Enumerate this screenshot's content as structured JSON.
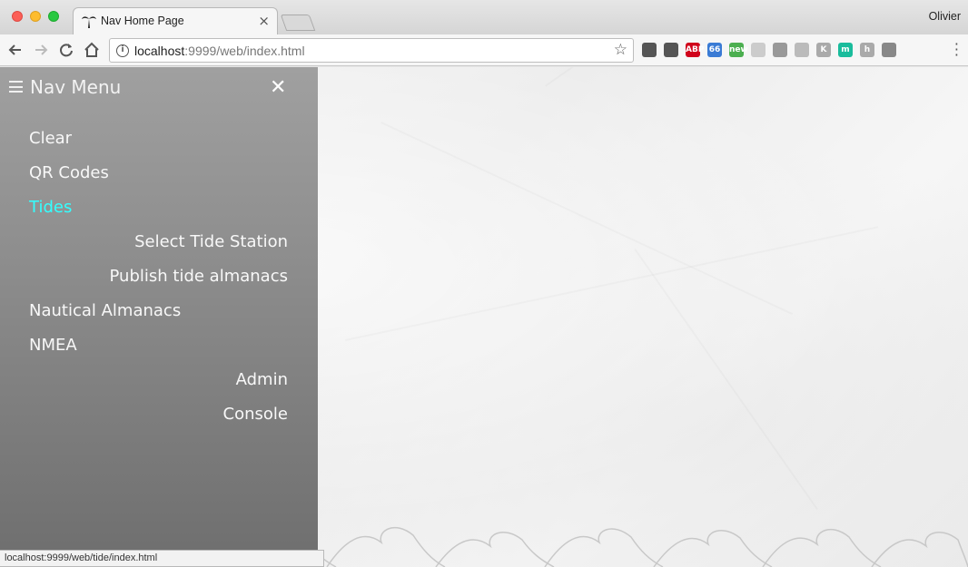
{
  "browser": {
    "tab_title": "Nav Home Page",
    "tab_close": "×",
    "profile_name": "Olivier",
    "url_host": "localhost",
    "url_rest": ":9999/web/index.html",
    "extensions": [
      {
        "name": "evernote-icon",
        "color": "#555555",
        "label": ""
      },
      {
        "name": "bug-icon",
        "color": "#555555",
        "label": ""
      },
      {
        "name": "adblock-icon",
        "color": "#d0021b",
        "label": "ABP"
      },
      {
        "name": "badge-66-icon",
        "color": "#3a7bd5",
        "label": "66"
      },
      {
        "name": "new-badge-icon",
        "color": "#4caf50",
        "label": "new"
      },
      {
        "name": "circle-ext-icon",
        "color": "#cccccc",
        "label": ""
      },
      {
        "name": "square-ext-icon",
        "color": "#999999",
        "label": ""
      },
      {
        "name": "cube-ext-icon",
        "color": "#bbbbbb",
        "label": ""
      },
      {
        "name": "k-ext-icon",
        "color": "#aaaaaa",
        "label": "K"
      },
      {
        "name": "m-ext-icon",
        "color": "#1abc9c",
        "label": "m"
      },
      {
        "name": "h-ext-icon",
        "color": "#aaaaaa",
        "label": "h"
      },
      {
        "name": "pocket-ext-icon",
        "color": "#888888",
        "label": ""
      }
    ]
  },
  "nav": {
    "title": "Nav Menu",
    "close_label": "✕",
    "items": [
      {
        "label": "Clear",
        "align": "left",
        "active": false
      },
      {
        "label": "QR Codes",
        "align": "left",
        "active": false
      },
      {
        "label": "Tides",
        "align": "left",
        "active": true
      },
      {
        "label": "Select Tide Station",
        "align": "right",
        "active": false
      },
      {
        "label": "Publish tide almanacs",
        "align": "right",
        "active": false
      },
      {
        "label": "Nautical Almanacs",
        "align": "left",
        "active": false
      },
      {
        "label": "NMEA",
        "align": "left",
        "active": false
      },
      {
        "label": "Admin",
        "align": "right",
        "active": false
      },
      {
        "label": "Console",
        "align": "right",
        "active": false
      }
    ],
    "active_color": "#33ffff"
  },
  "status_bar": {
    "text": "localhost:9999/web/tide/index.html"
  }
}
